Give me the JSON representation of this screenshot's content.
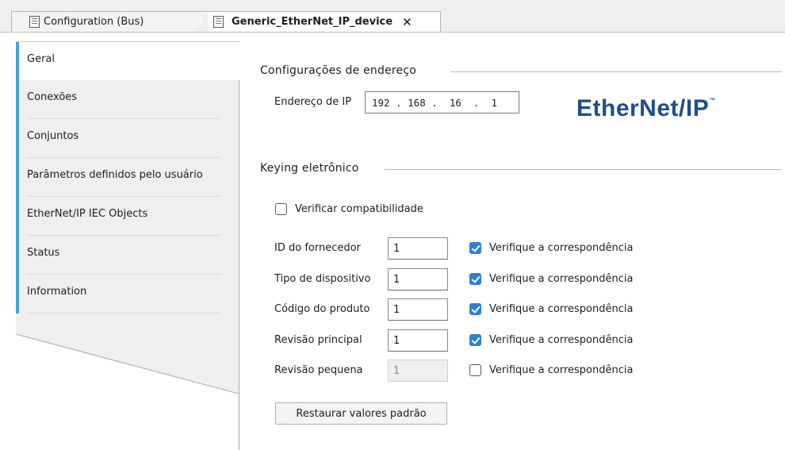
{
  "tabs": [
    {
      "label": "Configuration (Bus)",
      "icon": "device-tree-icon",
      "active": false
    },
    {
      "label": "Generic_EtherNet_IP_device",
      "icon": "device-icon",
      "active": true,
      "close": "✕"
    }
  ],
  "sidebar": {
    "items": [
      {
        "label": "Geral",
        "active": true
      },
      {
        "label": "Conexões"
      },
      {
        "label": "Conjuntos"
      },
      {
        "label": "Parâmetros definidos pelo usuário"
      },
      {
        "label": "EtherNet/IP IEC Objects"
      },
      {
        "label": "Status"
      },
      {
        "label": "Information"
      }
    ],
    "accent_color": "#4a9fe0"
  },
  "address": {
    "section_title": "Configurações de endereço",
    "ip_label": "Endereço de IP",
    "ip_value": "192 . 168 .  16  .  1"
  },
  "logo": {
    "text": "EtherNet/IP",
    "tm": "™",
    "color": "#1f4e8c"
  },
  "keying": {
    "section_title": "Keying eletrônico",
    "compat_label": "Verificar compatibilidade",
    "compat_checked": false,
    "check_label": "Verifique a correspondência",
    "rows": [
      {
        "label": "ID do fornecedor",
        "value": "1",
        "checked": true,
        "disabled": false
      },
      {
        "label": "Tipo de dispositivo",
        "value": "1",
        "checked": true,
        "disabled": false
      },
      {
        "label": "Código do produto",
        "value": "1",
        "checked": true,
        "disabled": false
      },
      {
        "label": "Revisão principal",
        "value": "1",
        "checked": true,
        "disabled": false
      },
      {
        "label": "Revisão pequena",
        "value": "1",
        "checked": false,
        "disabled": true
      }
    ],
    "restore_button": "Restaurar valores padrão"
  }
}
